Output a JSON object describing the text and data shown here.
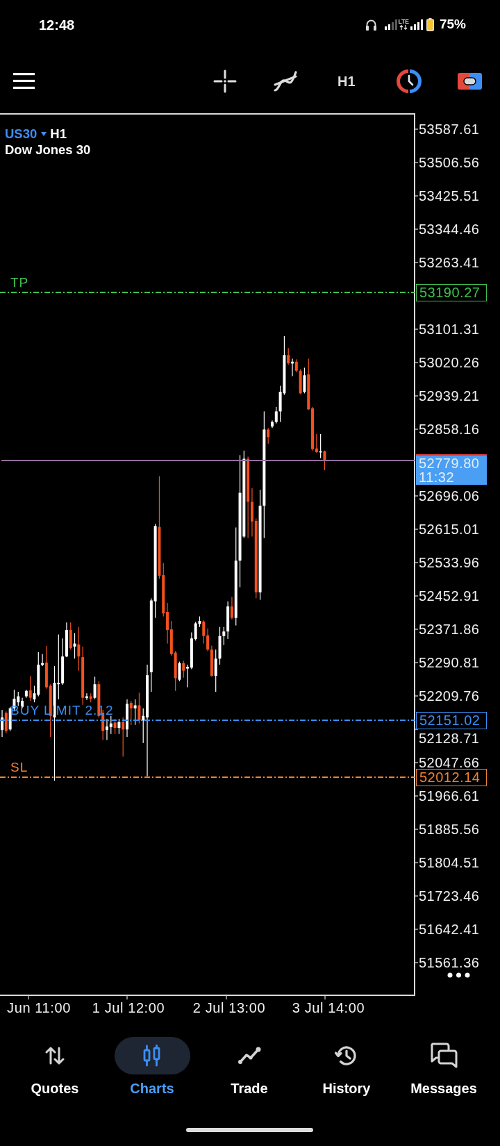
{
  "status_bar": {
    "time": "12:48",
    "network_type": "LTE",
    "battery": "75%"
  },
  "toolbar": {
    "timeframe": "H1"
  },
  "chart": {
    "symbol": "US30",
    "timeframe": "H1",
    "description": "Dow Jones 30",
    "price_axis": [
      "53587.61",
      "53506.56",
      "53425.51",
      "53344.46",
      "53263.41",
      "53101.31",
      "53020.26",
      "52939.21",
      "52858.16",
      "52696.06",
      "52615.01",
      "52533.96",
      "52452.91",
      "52371.86",
      "52290.81",
      "52209.76",
      "52128.71",
      "52047.66",
      "51966.61",
      "51885.56",
      "51804.51",
      "51723.46",
      "51642.41",
      "51561.36"
    ],
    "order_lines": [
      {
        "kind": "take_profit",
        "label": "TP",
        "price": "53190.27",
        "color": "#3ec24c"
      },
      {
        "kind": "buy_limit",
        "label": "BUY LIMIT 2.12",
        "price": "52151.02",
        "color": "#3a8ff5"
      },
      {
        "kind": "stop_loss",
        "label": "SL",
        "price": "52012.14",
        "color": "#f5802e"
      }
    ],
    "current_price": {
      "price": "52779.80",
      "countdown": "11:32"
    },
    "time_axis": [
      "Jun 11:00",
      "1 Jul 12:00",
      "2 Jul 13:00",
      "3 Jul 14:00"
    ]
  },
  "bottom_nav": [
    {
      "label": "Quotes",
      "selected": false
    },
    {
      "label": "Charts",
      "selected": true
    },
    {
      "label": "Trade",
      "selected": false
    },
    {
      "label": "History",
      "selected": false
    },
    {
      "label": "Messages",
      "selected": false
    }
  ]
}
